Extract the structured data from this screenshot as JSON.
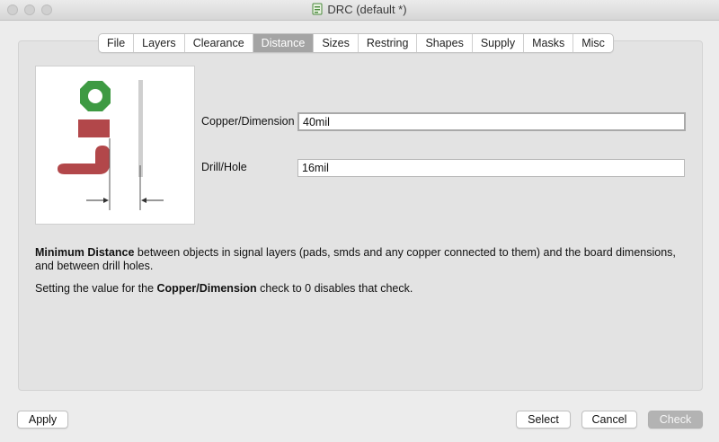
{
  "window": {
    "title": "DRC (default *)"
  },
  "tabs": [
    "File",
    "Layers",
    "Clearance",
    "Distance",
    "Sizes",
    "Restring",
    "Shapes",
    "Supply",
    "Masks",
    "Misc"
  ],
  "active_tab": "Distance",
  "fields": {
    "copper_dimension": {
      "label": "Copper/Dimension",
      "value": "40mil"
    },
    "drill_hole": {
      "label": "Drill/Hole",
      "value": "16mil"
    }
  },
  "description": {
    "p1_bold": "Minimum Distance",
    "p1_rest": " between objects in signal layers (pads, smds and any copper connected to them) and the board dimensions, and between drill holes.",
    "p2_pre": "Setting the value for the ",
    "p2_bold": "Copper/Dimension",
    "p2_post": " check to 0 disables that check."
  },
  "buttons": {
    "apply": "Apply",
    "select": "Select",
    "cancel": "Cancel",
    "check": "Check"
  },
  "colors": {
    "pad_green": "#3e9a43",
    "copper_red": "#b2474a",
    "active_tab": "#a4a4a4"
  },
  "icons": {
    "title": "drc-document-icon"
  }
}
